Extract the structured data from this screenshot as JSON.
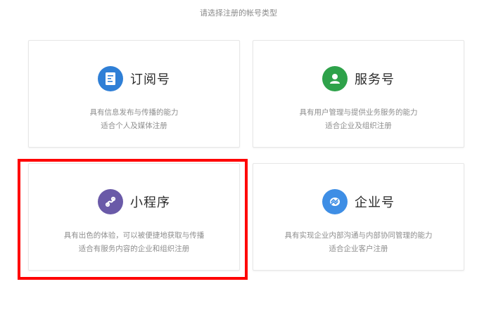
{
  "header": {
    "hint": "请选择注册的帐号类型"
  },
  "cards": [
    {
      "title": "订阅号",
      "desc_line1": "具有信息发布与传播的能力",
      "desc_line2": "适合个人及媒体注册",
      "icon": "document-icon",
      "icon_color": "#2f7fd6"
    },
    {
      "title": "服务号",
      "desc_line1": "具有用户管理与提供业务服务的能力",
      "desc_line2": "适合企业及组织注册",
      "icon": "user-icon",
      "icon_color": "#2ea24a"
    },
    {
      "title": "小程序",
      "desc_line1": "具有出色的体验，可以被便捷地获取与传播",
      "desc_line2": "适合有服务内容的企业和组织注册",
      "icon": "mini-program-icon",
      "icon_color": "#6a5aa8"
    },
    {
      "title": "企业号",
      "desc_line1": "具有实现企业内部沟通与内部协同管理的能力",
      "desc_line2": "适合企业客户注册",
      "icon": "enterprise-icon",
      "icon_color": "#3e8ee5"
    }
  ],
  "highlight": {
    "color": "#ff0000",
    "target": "小程序"
  }
}
